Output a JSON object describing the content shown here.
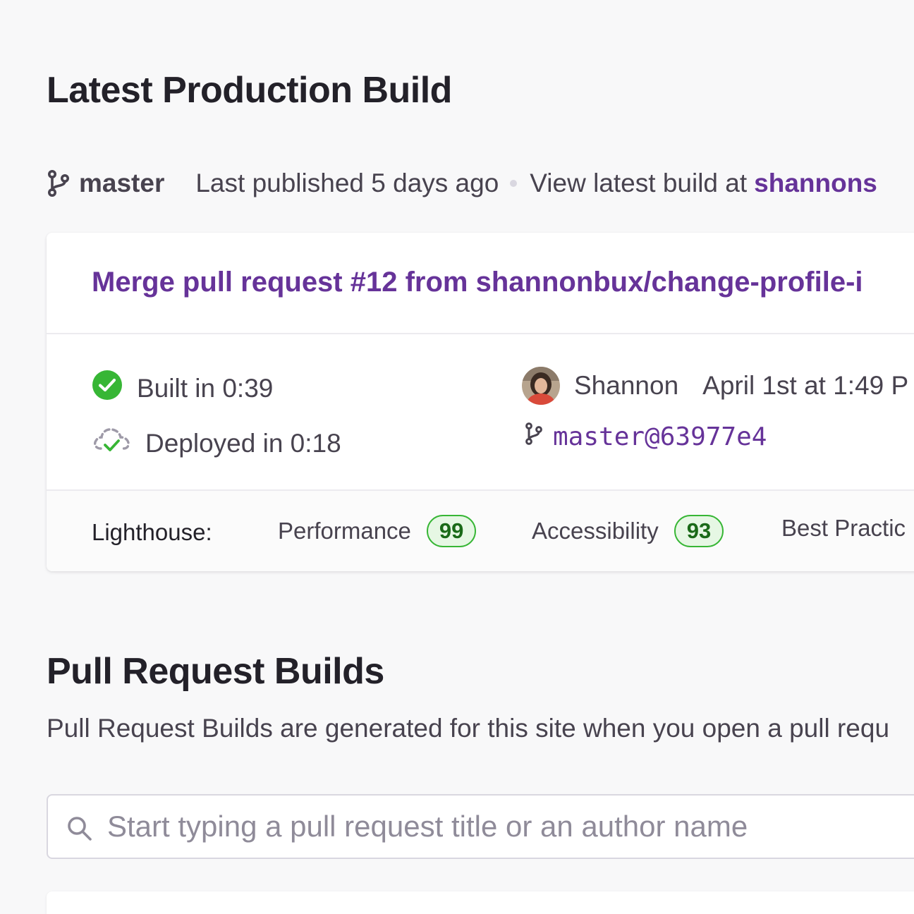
{
  "latest_build": {
    "title": "Latest Production Build",
    "branch": "master",
    "last_published": "Last published 5 days ago",
    "view_prefix": "View latest build at",
    "view_link": "shannons"
  },
  "build_card": {
    "commit_title": "Merge pull request #12 from shannonbux/change-profile-i",
    "built_text": "Built in 0:39",
    "deployed_text": "Deployed in 0:18",
    "author": "Shannon",
    "date": "April 1st at 1:49 P",
    "commit_ref": "master@63977e4",
    "lighthouse": {
      "label": "Lighthouse:",
      "metrics": [
        {
          "name": "Performance",
          "score": "99"
        },
        {
          "name": "Accessibility",
          "score": "93"
        },
        {
          "name": "Best Practic",
          "score": ""
        }
      ]
    }
  },
  "pr_builds": {
    "title": "Pull Request Builds",
    "description": "Pull Request Builds are generated for this site when you open a pull requ",
    "search_placeholder": "Start typing a pull request title or an author name"
  },
  "colors": {
    "accent_purple": "#663399",
    "success_green": "#37b635",
    "score_bg": "#e6f7e4"
  }
}
